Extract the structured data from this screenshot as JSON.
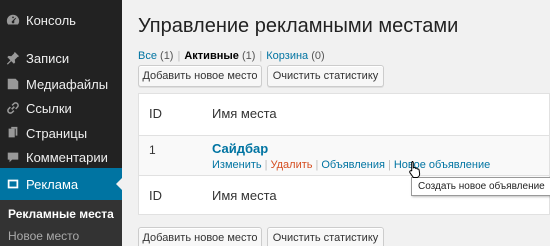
{
  "sidebar": {
    "items": [
      {
        "label": "Консоль",
        "icon": "dashboard-icon"
      },
      {
        "label": "Записи",
        "icon": "pin-icon"
      },
      {
        "label": "Медиафайлы",
        "icon": "media-icon"
      },
      {
        "label": "Ссылки",
        "icon": "link-icon"
      },
      {
        "label": "Страницы",
        "icon": "page-icon"
      },
      {
        "label": "Комментарии",
        "icon": "comment-icon"
      },
      {
        "label": "Реклама",
        "icon": "ad-icon"
      }
    ],
    "submenu": [
      {
        "label": "Рекламные места"
      },
      {
        "label": "Новое место"
      }
    ]
  },
  "header": {
    "title": "Управление рекламными местами"
  },
  "filters": {
    "all_label": "Все",
    "all_count": "(1)",
    "active_label": "Активные",
    "active_count": "(1)",
    "trash_label": "Корзина",
    "trash_count": "(0)"
  },
  "actions": {
    "add_label": "Добавить новое место",
    "clear_label": "Очистить статистику"
  },
  "table": {
    "col_id": "ID",
    "col_name": "Имя места",
    "rows": [
      {
        "id": "1",
        "name": "Сайдбар",
        "row_actions": [
          "Изменить",
          "Удалить",
          "Объявления",
          "Новое объявление"
        ]
      }
    ]
  },
  "tooltip": "Создать новое объявление",
  "colors": {
    "accent": "#0074a2",
    "sidebar_bg": "#222222",
    "delete": "#d54e21"
  }
}
